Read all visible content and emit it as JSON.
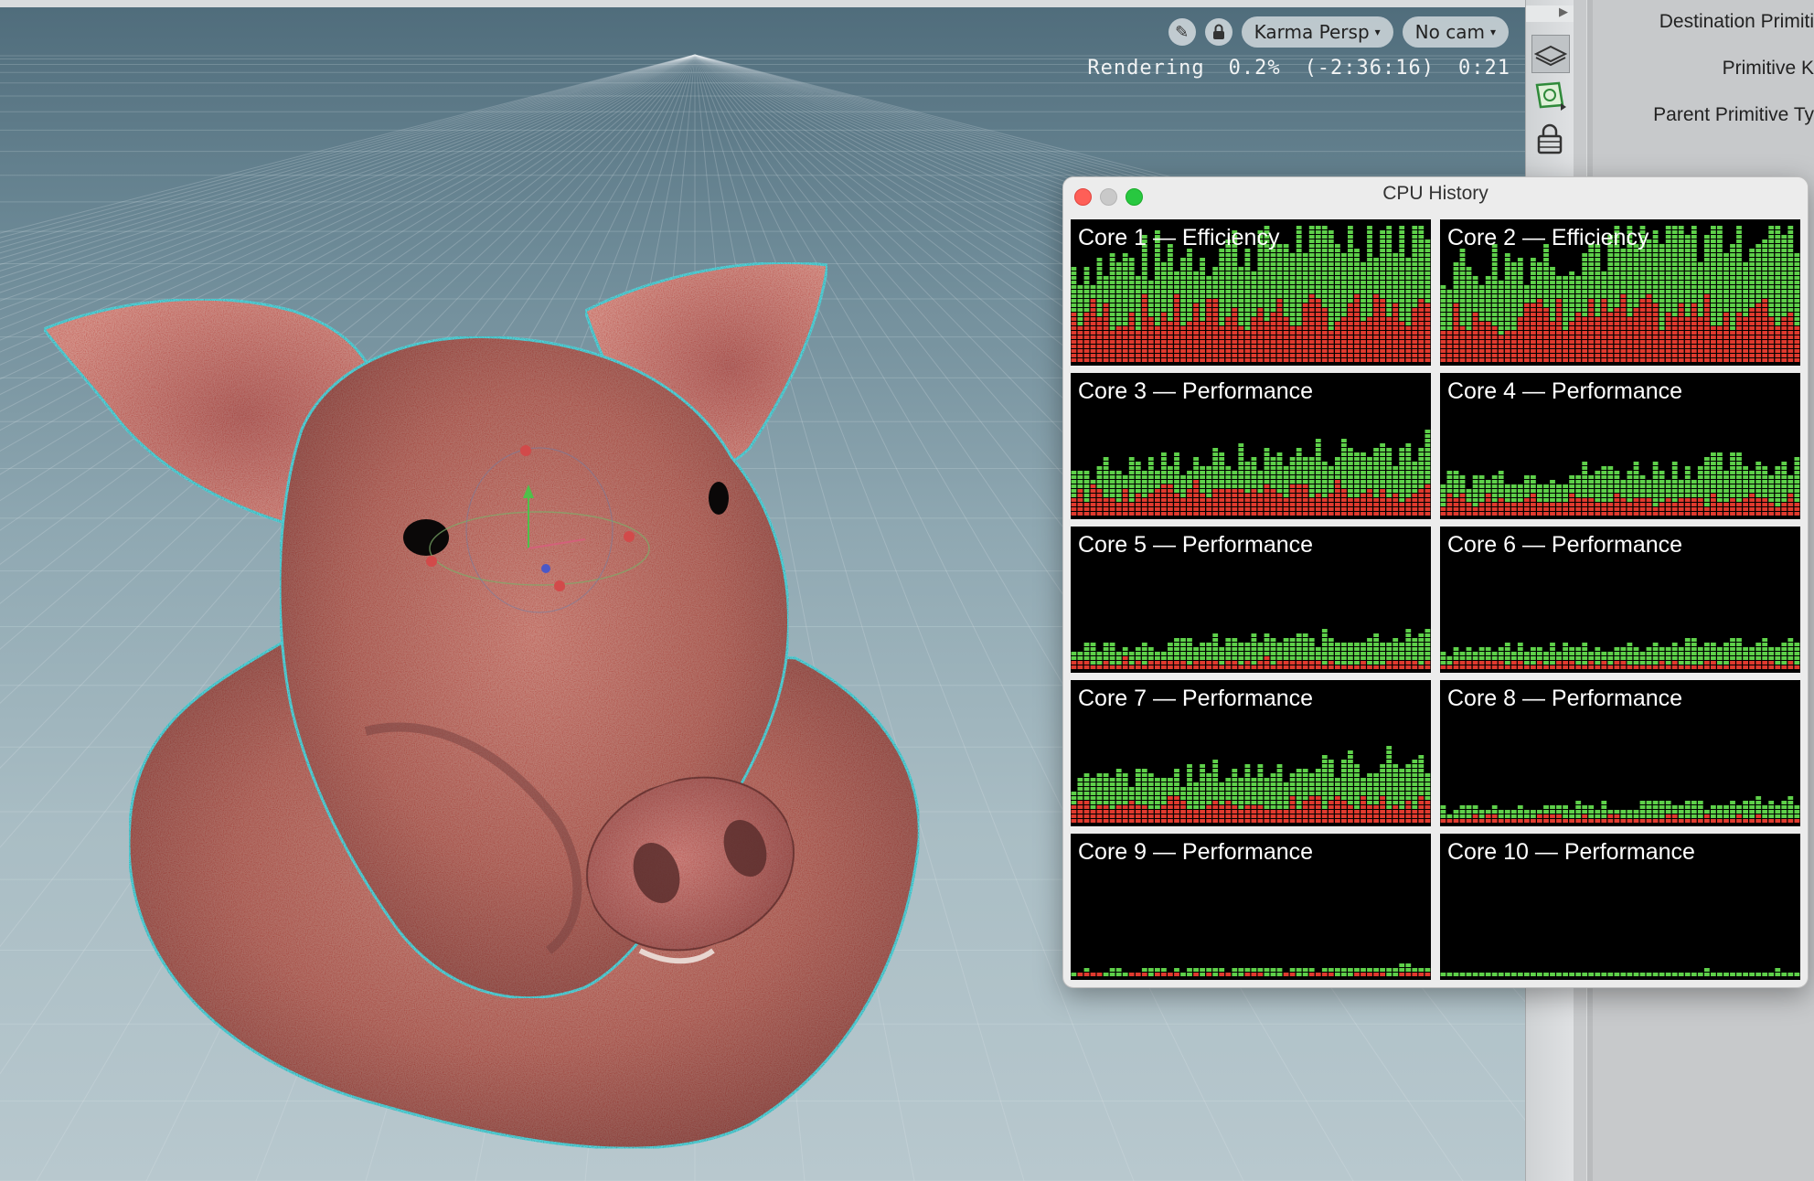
{
  "viewport": {
    "camera_menu": "Karma Persp",
    "cam_menu": "No cam",
    "status": {
      "label": "Rendering",
      "percent": "0.2%",
      "remaining": "(-2:36:16)",
      "elapsed": "0:21"
    },
    "icons": [
      "pencil-icon",
      "lock-icon"
    ]
  },
  "toolstrip": {
    "icons": [
      "play-arrow-icon",
      "display-options-icon",
      "render-region-icon",
      "lock-icon"
    ]
  },
  "params": {
    "labels": [
      "Destination Primiti",
      "Primitive K",
      "Parent Primitive Ty"
    ]
  },
  "cpu_window": {
    "title": "CPU History",
    "cores": [
      {
        "label": "Core 1 — Efficiency"
      },
      {
        "label": "Core 2 — Efficiency"
      },
      {
        "label": "Core 3 — Performance"
      },
      {
        "label": "Core 4 — Performance"
      },
      {
        "label": "Core 5 — Performance"
      },
      {
        "label": "Core 6 — Performance"
      },
      {
        "label": "Core 7 — Performance"
      },
      {
        "label": "Core 8 — Performance"
      },
      {
        "label": "Core 9 — Performance"
      },
      {
        "label": "Core 10 — Performance"
      }
    ]
  },
  "colors": {
    "user_load": "#5ed04a",
    "system_load": "#e03a2e",
    "graph_background": "#000000",
    "selection_outline": "#4fd8e0"
  }
}
